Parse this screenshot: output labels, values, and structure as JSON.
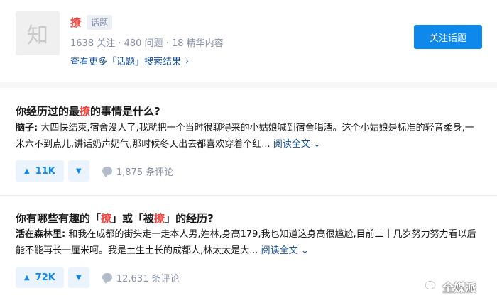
{
  "topic": {
    "avatar_char": "知",
    "name": "撩",
    "tag": "话题",
    "stats": "1638 关注 · 480 问题 · 18 精华内容",
    "more_link": "查看更多「话题」搜索结果",
    "follow_label": "关注话题"
  },
  "results": [
    {
      "title_before": "你经历过的最",
      "title_hl": "撩",
      "title_after": "的事情是什么?",
      "author": "脑子:",
      "excerpt": " 大四快结束,宿舍没人了,我就把一个当时很聊得来的小姑娘喊到宿舍喝酒。这个小姑娘是标准的轻音柔身,一米六不到点儿,讲话奶声奶气,那时候冬天出去都喜欢穿着个红...",
      "read_more": "阅读全文",
      "votes": "11K",
      "comments": "1,875 条评论"
    },
    {
      "title_p1": "你有哪些有趣的「",
      "title_hl1": "撩",
      "title_p2": "」或「被",
      "title_hl2": "撩",
      "title_p3": "」的经历?",
      "author": "活在森林里:",
      "excerpt": " 和我在成都的街头走一走本人男,姓林,身高179,我也知道这身高很尴尬,目前二十几岁努力努力看以后能不能再长一厘米呵。我是土生土长的成都人,林太太是大...",
      "read_more": "阅读全文",
      "votes": "72K",
      "comments": "12,631 条评论"
    }
  ],
  "watermark": "全媒派",
  "icons": {
    "chevron": "chevron-right-icon",
    "upvote": "upvote-triangle-icon",
    "downvote": "downvote-triangle-icon",
    "comment": "comment-bubble-icon"
  },
  "colors": {
    "accent": "#0f88eb",
    "highlight": "#f1403c",
    "link": "#175199",
    "muted": "#8590a6"
  }
}
